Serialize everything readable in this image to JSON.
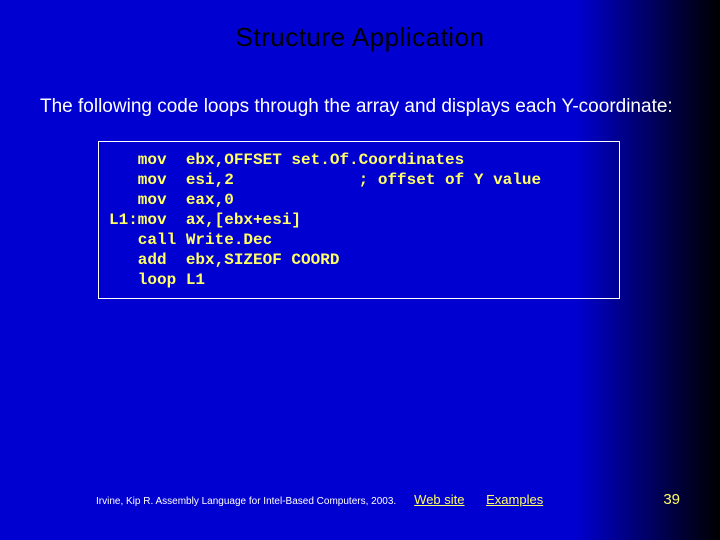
{
  "title": "Structure Application",
  "intro": "The following code loops through the array and displays each Y-coordinate:",
  "code": "   mov  ebx,OFFSET set.Of.Coordinates\n   mov  esi,2             ; offset of Y value\n   mov  eax,0\nL1:mov  ax,[ebx+esi]\n   call Write.Dec\n   add  ebx,SIZEOF COORD\n   loop L1",
  "footer": {
    "credit": "Irvine, Kip R. Assembly Language for Intel-Based Computers, 2003.",
    "link_web": "Web site",
    "link_examples": "Examples",
    "page": "39"
  }
}
